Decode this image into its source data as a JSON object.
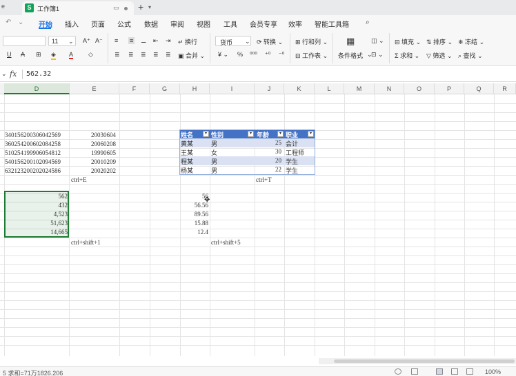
{
  "tabbar": {
    "left_fragment": "e",
    "doc_icon": "S",
    "doc_name": "工作簿1",
    "new_tab": "+"
  },
  "menu": [
    "开始",
    "插入",
    "页面",
    "公式",
    "数据",
    "审阅",
    "视图",
    "工具",
    "会员专享",
    "效率",
    "智能工具箱"
  ],
  "ribbon": {
    "font_size": "11",
    "wrap": "换行",
    "merge": "合并",
    "format": "货币",
    "convert": "转换",
    "row_col": "行和列",
    "worksheet": "工作表",
    "cond_format": "条件格式",
    "fill": "填充",
    "sort": "排序",
    "freeze": "冻结",
    "sum": "求和",
    "filter": "筛选",
    "find": "查找",
    "bold": "B",
    "underline": "U",
    "strike": "A"
  },
  "formula": {
    "fx": "fx",
    "value": "562.32"
  },
  "columns": [
    "D",
    "E",
    "F",
    "G",
    "H",
    "I",
    "J",
    "K",
    "L",
    "M",
    "N",
    "O",
    "P",
    "Q",
    "R"
  ],
  "col_d": [
    "340156200306042569",
    "360254200602084258",
    "510254199906054812",
    "540156200102094569",
    "632123200202024586"
  ],
  "col_e": [
    "20030604",
    "20060208",
    "19990605",
    "20010209",
    "20020202"
  ],
  "note_e": "ctrl+E",
  "note_j": "ctrl+T",
  "table": {
    "headers": [
      "姓名",
      "性别",
      "年龄",
      "职业"
    ],
    "rows": [
      [
        "黄某",
        "男",
        "25",
        "会计"
      ],
      [
        "王某",
        "女",
        "30",
        "工程师"
      ],
      [
        "程某",
        "男",
        "20",
        "学生"
      ],
      [
        "杨某",
        "男",
        "22",
        "学生"
      ]
    ]
  },
  "col_d2": [
    "562",
    "432",
    "4,523",
    "51,623",
    "14,665"
  ],
  "note_e2": "ctrl+shift+1",
  "col_h2": [
    "56",
    "56.56",
    "89.56",
    "15.88",
    "12.4"
  ],
  "note_i2": "ctrl+shift+5",
  "status": {
    "text": "5  求和=71万1826.206",
    "zoom": "100%"
  }
}
